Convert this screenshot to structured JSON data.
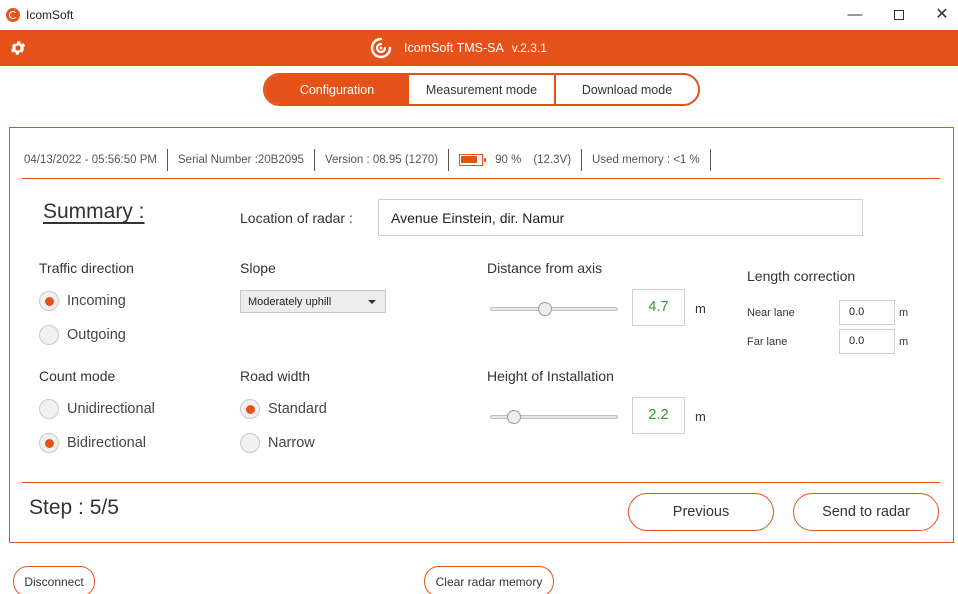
{
  "window": {
    "title": "IcomSoft",
    "minimize": "—",
    "close": "✕"
  },
  "header": {
    "app_name": "IcomSoft TMS-SA",
    "version": "v.2.3.1",
    "brand_color": "#e4521a"
  },
  "tabs": [
    {
      "label": "Configuration",
      "active": true
    },
    {
      "label": "Measurement mode",
      "active": false
    },
    {
      "label": "Download mode",
      "active": false
    }
  ],
  "status": {
    "datetime": "04/13/2022 - 05:56:50 PM",
    "serial": "Serial Number :20B2095",
    "version": "Version : 08.95 (1270)",
    "battery_percent": "90 %",
    "battery_voltage": "(12.3V)",
    "used_memory": "Used memory : <1 %"
  },
  "summary": {
    "title": "Summary :",
    "location_label": "Location of radar :",
    "location_value": "Avenue Einstein, dir. Namur"
  },
  "traffic_direction": {
    "label": "Traffic direction",
    "options": [
      {
        "label": "Incoming",
        "checked": true
      },
      {
        "label": "Outgoing",
        "checked": false
      }
    ]
  },
  "count_mode": {
    "label": "Count mode",
    "options": [
      {
        "label": "Unidirectional",
        "checked": false
      },
      {
        "label": "Bidirectional",
        "checked": true
      }
    ]
  },
  "slope": {
    "label": "Slope",
    "selected": "Moderately uphill"
  },
  "road_width": {
    "label": "Road width",
    "options": [
      {
        "label": "Standard",
        "checked": true
      },
      {
        "label": "Narrow",
        "checked": false
      }
    ]
  },
  "distance_from_axis": {
    "label": "Distance from axis",
    "value": "4.7",
    "unit": "m",
    "slider_fraction": 0.42
  },
  "height_of_installation": {
    "label": "Height of Installation",
    "value": "2.2",
    "unit": "m",
    "slider_fraction": 0.15
  },
  "length_correction": {
    "label": "Length correction",
    "near_lane_label": "Near lane",
    "near_lane_value": "0.0",
    "far_lane_label": "Far lane",
    "far_lane_value": "0.0",
    "unit": "m"
  },
  "footer": {
    "step": "Step : 5/5",
    "previous": "Previous",
    "send": "Send to radar"
  },
  "bottom": {
    "disconnect": "Disconnect",
    "clear_memory": "Clear radar memory"
  }
}
